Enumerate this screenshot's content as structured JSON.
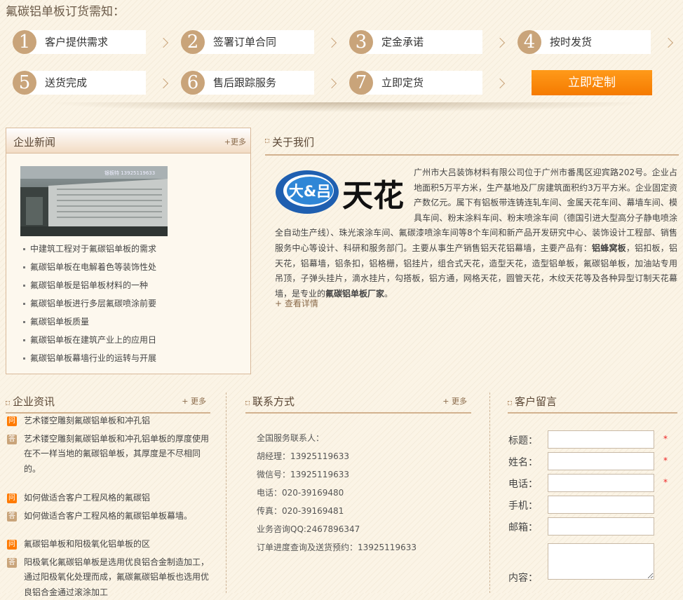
{
  "page_title": "氟碳铝单板订货需知：",
  "steps": [
    {
      "num": "1",
      "label": "客户提供需求"
    },
    {
      "num": "2",
      "label": "签署订单合同"
    },
    {
      "num": "3",
      "label": "定金承诺"
    },
    {
      "num": "4",
      "label": "按时发货"
    },
    {
      "num": "5",
      "label": "送货完成"
    },
    {
      "num": "6",
      "label": "售后跟踪服务"
    },
    {
      "num": "7",
      "label": "立即定货"
    }
  ],
  "cta_label": "立即定制",
  "news": {
    "title": "企业新闻",
    "more": "+更多",
    "image_caption": "银板特 13925119633",
    "items": [
      "中建筑工程对于氟碳铝单板的需求",
      "氟碳铝单板在电解着色等装饰性处",
      "氟碳铝单板是铝单板材料的一种",
      "氟碳铝单板进行多层氟碳喷涂前要",
      "氟碳铝单板质量",
      "氟碳铝单板在建筑产业上的应用日",
      "氟碳铝单板幕墙行业的运转与开展"
    ]
  },
  "about": {
    "title": "关于我们",
    "logo_text": "大&吕",
    "logo_brand": "天花",
    "text_1": "广州市大吕装饰材料有限公司位于广州市番禺区迎宾路202号。企业占地面积5万平方米，生产基地及厂房建筑面积约3万平方米。企业固定资产数亿元。属下有铝板带连铸连轧车间、金属天花车间、幕墙车间、模具车间、粉末涂料车间、粉末喷涂车间（德国引进大型高分子静电喷涂全自动生产线）、珠光滚涂车间、氟碳漆喷涂车间等8个车间和新产品开发研究中心、装饰设计工程部、销售服务中心等设计、科研和服务部门。主要从事生产销售铝天花铝幕墙，主要产品有：",
    "bold_1": "铝蜂窝板",
    "text_2": "，铝扣板，铝天花，铝幕墙，铝条扣，铝格栅，铝挂片，组合式天花，造型天花，造型铝单板，氟碳铝单板，加油站专用吊顶，子弹头挂片，滴水挂片，勾搭板，铝方通，网格天花，圆管天花，木纹天花等及各种异型订制天花幕墙，是专业的",
    "bold_2": "氟碳铝单板厂家",
    "text_3": "。",
    "more": "+ 查看详情"
  },
  "info": {
    "title": "企业资讯",
    "more": "+ 更多",
    "q_badge": "问",
    "a_badge": "答",
    "items": [
      {
        "q": "艺术镂空雕刻氟碳铝单板和冲孔铝",
        "a": "艺术镂空雕刻氟碳铝单板和冲孔铝单板的厚度使用在不一样当地的氟碳铝单板，其厚度是不尽相同的。"
      },
      {
        "q": "如何做适合客户工程风格的氟碳铝",
        "a": "如何做适合客户工程风格的氟碳铝单板幕墙。"
      },
      {
        "q": "氟碳铝单板和阳极氧化铝单板的区",
        "a": "阳极氧化氟碳铝单板是选用优良铝合金制造加工，通过阳极氧化处理而成，氟碳氟碳铝单板也选用优良铝合金通过滚涂加工"
      }
    ]
  },
  "contact": {
    "title": "联系方式",
    "more": "+ 更多",
    "lines": [
      "全国服务联系人：",
      "胡经理：13925119633",
      "微信号：13925119633",
      "电话：020-39169480",
      "传真：020-39169481",
      "业务咨询QQ:2467896347",
      "订单进度查询及送货预约：13925119633"
    ]
  },
  "message": {
    "title": "客户留言",
    "required_mark": "*",
    "fields": {
      "title": "标题：",
      "name": "姓名：",
      "phone": "电话：",
      "mobile": "手机：",
      "email": "邮箱：",
      "content": "内容："
    }
  }
}
